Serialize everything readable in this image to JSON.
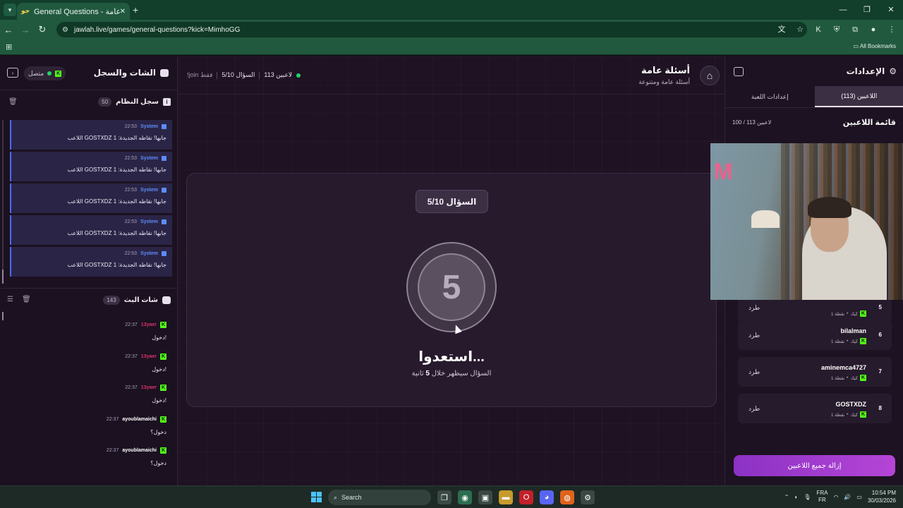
{
  "browser": {
    "tab_title": "General Questions - أسئلة عامة",
    "url": "jawlah.live/games/general-questions?kick=MimhoGG",
    "all_bookmarks": "All Bookmarks"
  },
  "left_panel": {
    "title": "الشات والسجل",
    "status": "متصل",
    "system_log": {
      "title": "سجل النظام",
      "count": "50",
      "messages": [
        {
          "name": "System",
          "time": "22:53",
          "text": "اللاعب GOSTXDZ جابها! نقاطه الجديدة: 1"
        },
        {
          "name": "System",
          "time": "22:53",
          "text": "اللاعب GOSTXDZ جابها! نقاطه الجديدة: 1"
        },
        {
          "name": "System",
          "time": "22:53",
          "text": "اللاعب GOSTXDZ جابها! نقاطه الجديدة: 1"
        },
        {
          "name": "System",
          "time": "22:53",
          "text": "اللاعب GOSTXDZ جابها! نقاطه الجديدة: 1"
        },
        {
          "name": "System",
          "time": "22:53",
          "text": "اللاعب GOSTXDZ جابها! نقاطه الجديدة: 1"
        }
      ]
    },
    "stream_chat": {
      "title": "شات البث",
      "count": "143",
      "messages": [
        {
          "user": "13yaer",
          "time": "22:37",
          "text": "دخول!",
          "color": "#d6336c"
        },
        {
          "user": "13yaer",
          "time": "22:37",
          "text": "دخول!",
          "color": "#d6336c"
        },
        {
          "user": "13yaer",
          "time": "22:37",
          "text": "دخول!",
          "color": "#d6336c"
        },
        {
          "user": "ayoublamaichi",
          "time": "22:37",
          "text": "دخول؟",
          "color": "#ffffff"
        },
        {
          "user": "ayoublamaichi",
          "time": "22:37",
          "text": "دخول؟",
          "color": "#ffffff"
        }
      ]
    }
  },
  "center": {
    "game_title": "أسئلة عامة",
    "game_subtitle": "أسئلة عامة ومتنوعة",
    "players_stat": "113 لاعبين",
    "question_stat": "السؤال 5/10",
    "join_hint": "!join فقط",
    "question_pill": "السؤال 5/10",
    "timer_value": "5",
    "ready_text": "استعدوا...",
    "ready_sub_prefix": "السؤال سيظهر خلال ",
    "ready_sub_value": "5",
    "ready_sub_suffix": " ثانية"
  },
  "right_panel": {
    "title": "الإعدادات",
    "tabs": [
      "اللاعبين (113)",
      "إعدادات اللعبة"
    ],
    "players_title": "قائمة اللاعبين",
    "players_count": "100 / 113 لاعبين",
    "players": [
      {
        "rank": "5",
        "name": "",
        "platform": "كيك",
        "points": "1 نقطة",
        "kick_label": "طرد"
      },
      {
        "rank": "6",
        "name": "bilalman",
        "platform": "كيك",
        "points": "1 نقطة",
        "kick_label": "طرد"
      },
      {
        "rank": "7",
        "name": "aminemca4727",
        "platform": "كيك",
        "points": "1 نقطة",
        "kick_label": "طرد"
      },
      {
        "rank": "8",
        "name": "GOSTXDZ",
        "platform": "كيك",
        "points": "1 نقطة",
        "kick_label": "طرد"
      }
    ],
    "remove_all": "إزالة جميع اللاعبين"
  },
  "taskbar": {
    "search": "Search",
    "lang_top": "FRA",
    "lang_bottom": "FR",
    "time": "10:54 PM",
    "date": "30/03/2026"
  },
  "colors": {
    "accent_purple": "#a23fd0",
    "kick_green": "#53fc18",
    "system_blue": "#5e8bff"
  }
}
